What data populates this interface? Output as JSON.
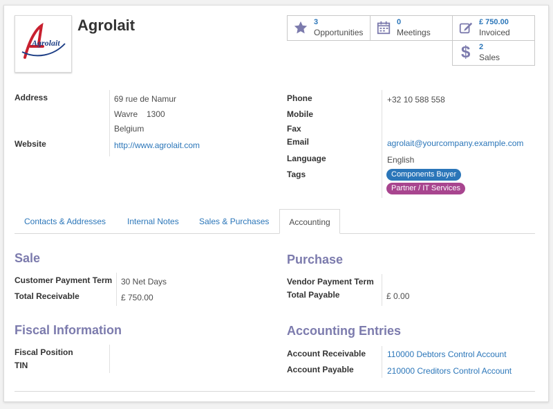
{
  "partner": {
    "name": "Agrolait",
    "logo_text": "Agrolait"
  },
  "stats": {
    "opportunities": {
      "count": "3",
      "label": "Opportunities",
      "icon": "star-icon"
    },
    "meetings": {
      "count": "0",
      "label": "Meetings",
      "icon": "calendar-icon"
    },
    "invoiced": {
      "count": "£ 750.00",
      "label": "Invoiced",
      "icon": "edit-icon"
    },
    "sales": {
      "count": "2",
      "label": "Sales",
      "icon": "dollar-icon"
    }
  },
  "address": {
    "label": "Address",
    "street": "69 rue de Namur",
    "city": "Wavre",
    "zip": "1300",
    "country": "Belgium"
  },
  "website": {
    "label": "Website",
    "value": "http://www.agrolait.com"
  },
  "contact": {
    "phone_label": "Phone",
    "phone": "+32 10 588 558",
    "mobile_label": "Mobile",
    "fax_label": "Fax",
    "email_label": "Email",
    "email": "agrolait@yourcompany.example.com",
    "language_label": "Language",
    "language": "English",
    "tags_label": "Tags",
    "tags": [
      {
        "label": "Components Buyer",
        "color": "#2b76b9"
      },
      {
        "label": "Partner / IT Services",
        "color": "#a8458f"
      }
    ]
  },
  "tabs": [
    {
      "label": "Contacts & Addresses"
    },
    {
      "label": "Internal Notes"
    },
    {
      "label": "Sales & Purchases"
    },
    {
      "label": "Accounting"
    }
  ],
  "sale": {
    "title": "Sale",
    "payment_term_label": "Customer Payment Term",
    "payment_term": "30 Net Days",
    "receivable_label": "Total Receivable",
    "receivable": "£ 750.00"
  },
  "purchase": {
    "title": "Purchase",
    "payment_term_label": "Vendor Payment Term",
    "payable_label": "Total Payable",
    "payable": "£ 0.00"
  },
  "fiscal": {
    "title": "Fiscal Information",
    "position_label": "Fiscal Position",
    "tin_label": "TIN"
  },
  "entries": {
    "title": "Accounting Entries",
    "receivable_label": "Account Receivable",
    "receivable": "110000 Debtors Control Account",
    "payable_label": "Account Payable",
    "payable": "210000 Creditors Control Account"
  },
  "colors": {
    "link": "#2b76b9",
    "section_title": "#7c7bad",
    "stat_icon": "#7c7bad"
  }
}
